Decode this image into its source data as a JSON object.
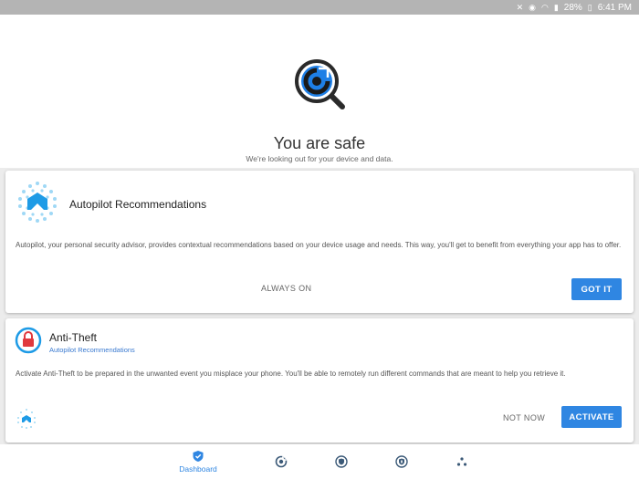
{
  "status_bar": {
    "battery": "28%",
    "time": "6:41 PM"
  },
  "hero": {
    "title": "You are safe",
    "subtitle": "We're looking out for your device and data."
  },
  "autopilot_card": {
    "title": "Autopilot Recommendations",
    "body": "Autopilot, your personal security advisor, provides contextual recommendations based on your device usage and needs. This way, you'll get to benefit from everything your app has to offer.",
    "secondary_button": "ALWAYS ON",
    "primary_button": "GOT IT"
  },
  "antitheft_card": {
    "title": "Anti-Theft",
    "subtitle": "Autopilot Recommendations",
    "body": "Activate Anti-Theft to be prepared in the unwanted event you misplace your phone. You'll be able to remotely run different commands that are meant to help you retrieve it.",
    "secondary_button": "NOT NOW",
    "primary_button": "ACTIVATE"
  },
  "bottom_nav": {
    "items": [
      {
        "label": "Dashboard",
        "icon": "shield-check-icon",
        "active": true
      },
      {
        "label": "",
        "icon": "scan-icon",
        "active": false
      },
      {
        "label": "",
        "icon": "privacy-shield-icon",
        "active": false
      },
      {
        "label": "",
        "icon": "lock-shield-icon",
        "active": false
      },
      {
        "label": "",
        "icon": "more-dots-icon",
        "active": false
      }
    ]
  },
  "colors": {
    "accent": "#2f86e2",
    "nav_icon": "#3c5a78",
    "danger": "#e0393e"
  }
}
